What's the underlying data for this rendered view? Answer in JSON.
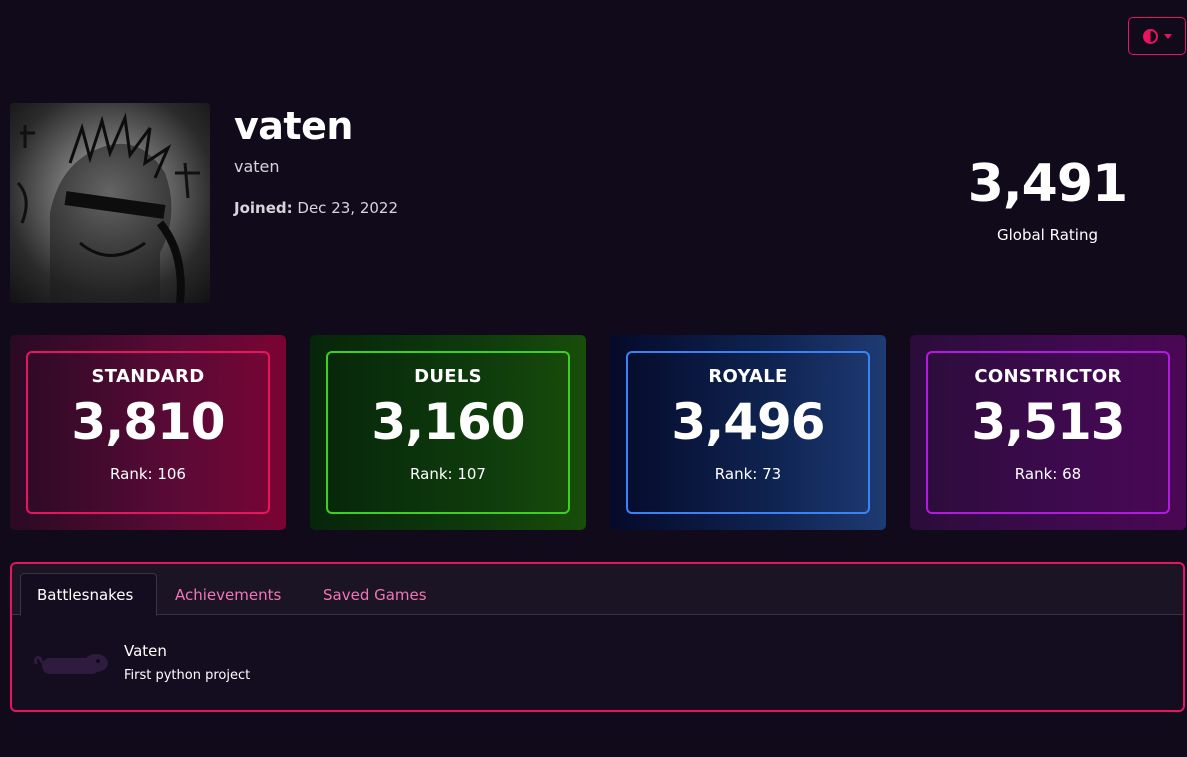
{
  "theme_toggle": {
    "icon": "contrast-half-circle-icon",
    "accent": "#e8145e"
  },
  "profile": {
    "display_name": "vaten",
    "username": "vaten",
    "joined_label": "Joined:",
    "joined_date": "Dec 23, 2022"
  },
  "global": {
    "rating": "3,491",
    "label": "Global Rating"
  },
  "modes": [
    {
      "name": "STANDARD",
      "rating": "3,810",
      "rank": "Rank: 106",
      "color": "#e8145e"
    },
    {
      "name": "DUELS",
      "rating": "3,160",
      "rank": "Rank: 107",
      "color": "#3fcf21"
    },
    {
      "name": "ROYALE",
      "rating": "3,496",
      "rank": "Rank: 73",
      "color": "#3b82f6"
    },
    {
      "name": "CONSTRICTOR",
      "rating": "3,513",
      "rank": "Rank: 68",
      "color": "#b31ae0"
    }
  ],
  "tabs": [
    {
      "label": "Battlesnakes",
      "active": true
    },
    {
      "label": "Achievements",
      "active": false
    },
    {
      "label": "Saved Games",
      "active": false
    }
  ],
  "battlesnakes": [
    {
      "name": "Vaten",
      "description": "First python project",
      "icon": "snake-icon",
      "color": "#2e1b3e"
    }
  ]
}
